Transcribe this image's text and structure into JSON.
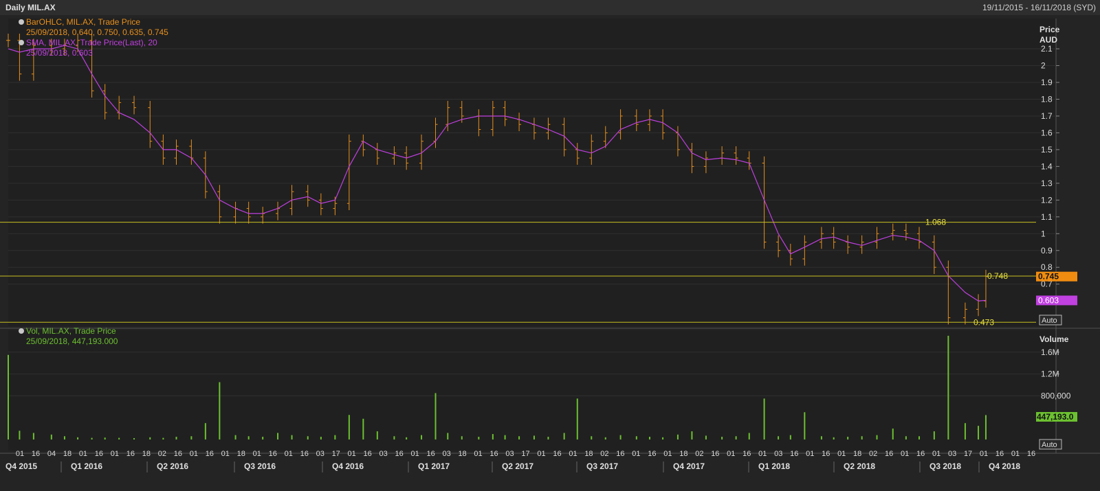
{
  "header": {
    "title": "Daily MIL.AX",
    "date_range": "19/11/2015 - 16/11/2018 (SYD)"
  },
  "price_pane": {
    "legend": [
      {
        "label": "BarOHLC, MIL.AX, Trade Price",
        "value": "25/09/2018, 0.640, 0.750, 0.635, 0.745",
        "color": "#e8901c"
      },
      {
        "label": "SMA, MIL.AX, Trade Price(Last),  20",
        "value": "25/09/2018, 0.603",
        "color": "#c040e0"
      }
    ],
    "axis_title_1": "Price",
    "axis_title_2": "AUD",
    "y_ticks": [
      "2.1",
      "2",
      "1.9",
      "1.8",
      "1.7",
      "1.6",
      "1.5",
      "1.4",
      "1.3",
      "1.2",
      "1.1",
      "1",
      "0.9",
      "0.8",
      "0.7"
    ],
    "y_tick_values": [
      2.1,
      2.0,
      1.9,
      1.8,
      1.7,
      1.6,
      1.5,
      1.4,
      1.3,
      1.2,
      1.1,
      1.0,
      0.9,
      0.8,
      0.7
    ],
    "last_price_tag": "0.745",
    "sma_tag": "0.603",
    "auto_label": "Auto",
    "hlines": [
      {
        "value": 1.068,
        "label": "1.068"
      },
      {
        "value": 0.748,
        "label": "0.748"
      },
      {
        "value": 0.473,
        "label": "0.473"
      }
    ]
  },
  "volume_pane": {
    "legend_label": "Vol, MIL.AX, Trade Price",
    "legend_value": "25/09/2018, 447,193.000",
    "axis_title": "Volume",
    "y_ticks": [
      "1.6M",
      "1.2M",
      "800,000"
    ],
    "y_tick_values": [
      1600000,
      1200000,
      800000
    ],
    "last_volume_tag": "447,193.0",
    "auto_label": "Auto"
  },
  "x_axis": {
    "day_labels": [
      "01",
      "16",
      "04",
      "18",
      "01",
      "16",
      "01",
      "16",
      "18",
      "02",
      "16",
      "01",
      "16",
      "01",
      "18",
      "01",
      "16",
      "01",
      "16",
      "03",
      "17",
      "01",
      "16",
      "03",
      "16",
      "01",
      "16",
      "03",
      "18",
      "01",
      "16",
      "03",
      "17",
      "01",
      "16",
      "01",
      "18",
      "02",
      "16",
      "01",
      "16",
      "01",
      "18",
      "02",
      "16",
      "01",
      "16",
      "01",
      "03",
      "16",
      "01",
      "16",
      "01",
      "18",
      "02",
      "16",
      "01",
      "16",
      "01",
      "03",
      "17",
      "01",
      "16",
      "01",
      "16"
    ],
    "quarters": [
      "Q4 2015",
      "Q1 2016",
      "Q2 2016",
      "Q3 2016",
      "Q4 2016",
      "Q1 2017",
      "Q2 2017",
      "Q3 2017",
      "Q4 2017",
      "Q1 2018",
      "Q2 2018",
      "Q3 2018",
      "Q4 2018"
    ]
  },
  "chart_data": [
    {
      "type": "line",
      "title": "Daily MIL.AX",
      "ylabel": "Price AUD",
      "ylim": [
        0.47,
        2.28
      ],
      "x": [
        "2015-11-19",
        "2015-12-01",
        "2015-12-16",
        "2016-01-04",
        "2016-01-18",
        "2016-02-01",
        "2016-02-16",
        "2016-03-01",
        "2016-03-16",
        "2016-04-01",
        "2016-04-18",
        "2016-05-02",
        "2016-05-16",
        "2016-06-01",
        "2016-06-16",
        "2016-07-01",
        "2016-07-18",
        "2016-08-01",
        "2016-08-16",
        "2016-09-01",
        "2016-09-16",
        "2016-10-03",
        "2016-10-17",
        "2016-11-01",
        "2016-11-16",
        "2016-12-01",
        "2016-12-16",
        "2017-01-03",
        "2017-01-16",
        "2017-02-01",
        "2017-02-16",
        "2017-03-01",
        "2017-03-16",
        "2017-04-03",
        "2017-04-18",
        "2017-05-01",
        "2017-05-16",
        "2017-06-01",
        "2017-06-16",
        "2017-07-03",
        "2017-07-17",
        "2017-08-01",
        "2017-08-16",
        "2017-09-01",
        "2017-09-18",
        "2017-10-02",
        "2017-10-16",
        "2017-11-01",
        "2017-11-16",
        "2017-12-01",
        "2017-12-18",
        "2018-01-02",
        "2018-01-16",
        "2018-02-01",
        "2018-02-16",
        "2018-03-01",
        "2018-03-16",
        "2018-04-03",
        "2018-04-16",
        "2018-05-01",
        "2018-05-16",
        "2018-06-01",
        "2018-06-18",
        "2018-07-02",
        "2018-07-16",
        "2018-08-01",
        "2018-08-16",
        "2018-09-03",
        "2018-09-17",
        "2018-09-25"
      ],
      "series": [
        {
          "name": "BarOHLC, MIL.AX, Trade Price",
          "values": [
            2.15,
            1.95,
            2.12,
            2.1,
            2.12,
            2.15,
            1.85,
            1.72,
            1.78,
            1.75,
            1.55,
            1.45,
            1.52,
            1.45,
            1.25,
            1.1,
            1.15,
            1.1,
            1.12,
            1.15,
            1.25,
            1.2,
            1.15,
            1.18,
            1.55,
            1.5,
            1.45,
            1.48,
            1.42,
            1.55,
            1.65,
            1.75,
            1.7,
            1.62,
            1.75,
            1.68,
            1.65,
            1.6,
            1.65,
            1.5,
            1.45,
            1.55,
            1.6,
            1.7,
            1.65,
            1.7,
            1.6,
            1.5,
            1.4,
            1.45,
            1.48,
            1.45,
            1.42,
            0.95,
            0.9,
            0.85,
            0.95,
            1.0,
            0.95,
            0.92,
            0.95,
            1.0,
            1.02,
            1.0,
            0.95,
            0.8,
            0.5,
            0.55,
            0.6,
            0.745
          ]
        },
        {
          "name": "SMA, MIL.AX, Trade Price(Last),  20",
          "values": [
            2.1,
            2.08,
            2.1,
            2.1,
            2.12,
            2.1,
            1.95,
            1.82,
            1.72,
            1.68,
            1.6,
            1.5,
            1.5,
            1.45,
            1.35,
            1.2,
            1.15,
            1.12,
            1.12,
            1.15,
            1.2,
            1.22,
            1.18,
            1.2,
            1.4,
            1.55,
            1.5,
            1.47,
            1.45,
            1.48,
            1.55,
            1.65,
            1.68,
            1.7,
            1.7,
            1.7,
            1.68,
            1.65,
            1.62,
            1.58,
            1.5,
            1.48,
            1.52,
            1.62,
            1.66,
            1.68,
            1.66,
            1.6,
            1.48,
            1.44,
            1.45,
            1.44,
            1.42,
            1.2,
            1.0,
            0.88,
            0.92,
            0.97,
            0.98,
            0.95,
            0.93,
            0.96,
            0.99,
            0.98,
            0.96,
            0.9,
            0.75,
            0.65,
            0.6,
            0.603
          ]
        }
      ],
      "hlines": [
        1.068,
        0.748,
        0.473
      ]
    },
    {
      "type": "bar",
      "title": "Vol, MIL.AX, Trade Price",
      "ylabel": "Volume",
      "ylim": [
        0,
        2000000
      ],
      "series": [
        {
          "name": "Vol, MIL.AX, Trade Price",
          "values": [
            1550000,
            160000,
            120000,
            90000,
            60000,
            40000,
            30000,
            35000,
            30000,
            25000,
            40000,
            30000,
            50000,
            60000,
            300000,
            1050000,
            80000,
            60000,
            50000,
            120000,
            80000,
            60000,
            50000,
            80000,
            450000,
            380000,
            150000,
            60000,
            40000,
            80000,
            850000,
            120000,
            60000,
            50000,
            100000,
            80000,
            60000,
            70000,
            50000,
            120000,
            750000,
            60000,
            40000,
            80000,
            60000,
            50000,
            40000,
            90000,
            150000,
            70000,
            50000,
            60000,
            120000,
            750000,
            60000,
            80000,
            500000,
            60000,
            40000,
            50000,
            60000,
            80000,
            200000,
            60000,
            60000,
            150000,
            1900000,
            300000,
            250000,
            447193
          ]
        }
      ]
    }
  ]
}
